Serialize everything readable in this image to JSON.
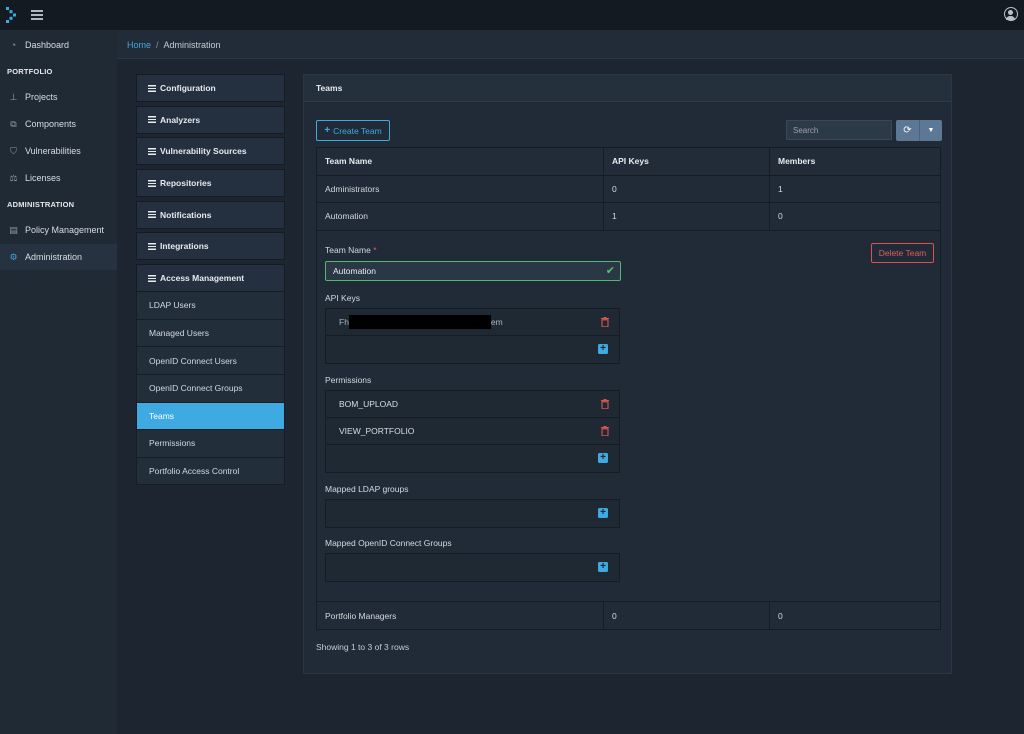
{
  "sidebar": {
    "items": [
      {
        "label": "Dashboard",
        "icon": "dashboard-icon"
      },
      {
        "label": "Projects",
        "icon": "sitemap-icon"
      },
      {
        "label": "Components",
        "icon": "cubes-icon"
      },
      {
        "label": "Vulnerabilities",
        "icon": "shield-icon"
      },
      {
        "label": "Licenses",
        "icon": "balance-scale-icon"
      },
      {
        "label": "Policy Management",
        "icon": "list-alt-icon"
      },
      {
        "label": "Administration",
        "icon": "cogs-icon"
      }
    ],
    "headings": {
      "portfolio": "PORTFOLIO",
      "administration": "ADMINISTRATION"
    }
  },
  "breadcrumb": {
    "home": "Home",
    "separator": "/",
    "current": "Administration"
  },
  "admin_menu": {
    "sections": [
      "Configuration",
      "Analyzers",
      "Vulnerability Sources",
      "Repositories",
      "Notifications",
      "Integrations",
      "Access Management"
    ],
    "access_items": [
      "LDAP Users",
      "Managed Users",
      "OpenID Connect Users",
      "OpenID Connect Groups",
      "Teams",
      "Permissions",
      "Portfolio Access Control"
    ]
  },
  "teams": {
    "title": "Teams",
    "create_label": "Create Team",
    "search_placeholder": "Search",
    "columns": [
      "Team Name",
      "API Keys",
      "Members"
    ],
    "rows": [
      {
        "name": "Administrators",
        "api_keys": "0",
        "members": "1"
      },
      {
        "name": "Automation",
        "api_keys": "1",
        "members": "0"
      },
      {
        "name": "Portfolio Managers",
        "api_keys": "0",
        "members": "0"
      }
    ],
    "footer": "Showing 1 to 3 of 3 rows"
  },
  "detail": {
    "team_name_label": "Team Name",
    "required_mark": "*",
    "team_name_value": "Automation",
    "delete_label": "Delete Team",
    "api_keys_label": "API Keys",
    "api_key_prefix": "Fh",
    "api_key_suffix": "em",
    "permissions_label": "Permissions",
    "permissions": [
      "BOM_UPLOAD",
      "VIEW_PORTFOLIO"
    ],
    "ldap_label": "Mapped LDAP groups",
    "oidc_label": "Mapped OpenID Connect Groups"
  },
  "colors": {
    "accent": "#3fa9e1",
    "danger": "#e25c5c",
    "success": "#4fc46d"
  }
}
